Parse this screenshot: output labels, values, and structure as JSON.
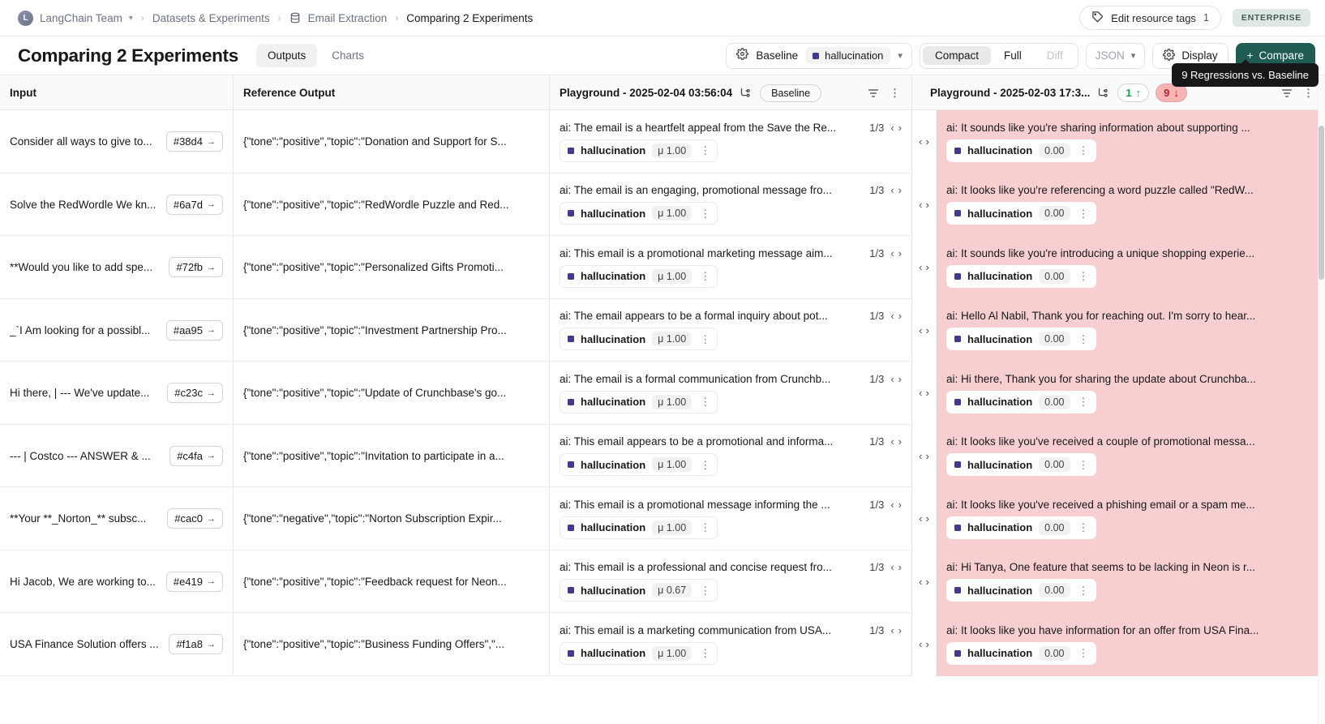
{
  "breadcrumb": {
    "team_initial": "L",
    "team": "LangChain Team",
    "level2": "Datasets & Experiments",
    "level3": "Email Extraction",
    "level4": "Comparing 2 Experiments",
    "tags_label": "Edit resource tags",
    "tags_count": "1",
    "plan_badge": "ENTERPRISE"
  },
  "toolbar": {
    "title": "Comparing 2 Experiments",
    "tabs": [
      {
        "label": "Outputs",
        "selected": true
      },
      {
        "label": "Charts",
        "selected": false
      }
    ],
    "baseline_label": "Baseline",
    "baseline_metric": "hallucination",
    "view_modes": [
      {
        "label": "Compact",
        "state": "active"
      },
      {
        "label": "Full",
        "state": "normal"
      },
      {
        "label": "Diff",
        "state": "disabled"
      }
    ],
    "json_label": "JSON",
    "display_label": "Display",
    "compare_label": "Compare",
    "compare_plus": "+",
    "tooltip": "9 Regressions vs. Baseline"
  },
  "table": {
    "headers": {
      "input": "Input",
      "reference_output": "Reference Output",
      "experiment_1": {
        "title": "Playground - 2025-02-04 03:56:04",
        "baseline_tag": "Baseline"
      },
      "experiment_2": {
        "title": "Playground - 2025-02-03 17:3...",
        "improvements": "1",
        "improvements_arrow": "↑",
        "regressions": "9",
        "regressions_arrow": "↓"
      }
    },
    "rows": [
      {
        "input": "Consider all ways to give to...",
        "hash": "#38d4",
        "reference": "{\"tone\":\"positive\",\"topic\":\"Donation and Support for S...",
        "exp1_text": "ai: The email is a heartfelt appeal from the Save the Re...",
        "exp1_frac": "1/3",
        "exp1_metric": "hallucination",
        "exp1_score": "μ 1.00",
        "exp2_text": "ai: It sounds like you're sharing information about supporting ...",
        "exp2_metric": "hallucination",
        "exp2_score": "0.00",
        "regression": true
      },
      {
        "input": "Solve the RedWordle We kn...",
        "hash": "#6a7d",
        "reference": "{\"tone\":\"positive\",\"topic\":\"RedWordle Puzzle and Red...",
        "exp1_text": "ai: The email is an engaging, promotional message fro...",
        "exp1_frac": "1/3",
        "exp1_metric": "hallucination",
        "exp1_score": "μ 1.00",
        "exp2_text": "ai: It looks like you're referencing a word puzzle called \"RedW...",
        "exp2_metric": "hallucination",
        "exp2_score": "0.00",
        "regression": true
      },
      {
        "input": "**Would you like to add spe...",
        "hash": "#72fb",
        "reference": "{\"tone\":\"positive\",\"topic\":\"Personalized Gifts Promoti...",
        "exp1_text": "ai: This email is a promotional marketing message aim...",
        "exp1_frac": "1/3",
        "exp1_metric": "hallucination",
        "exp1_score": "μ 1.00",
        "exp2_text": "ai: It sounds like you're introducing a unique shopping experie...",
        "exp2_metric": "hallucination",
        "exp2_score": "0.00",
        "regression": true
      },
      {
        "input": "_`I Am looking for a possibl...",
        "hash": "#aa95",
        "reference": "{\"tone\":\"positive\",\"topic\":\"Investment Partnership Pro...",
        "exp1_text": "ai: The email appears to be a formal inquiry about pot...",
        "exp1_frac": "1/3",
        "exp1_metric": "hallucination",
        "exp1_score": "μ 1.00",
        "exp2_text": "ai: Hello Al Nabil, Thank you for reaching out. I'm sorry to hear...",
        "exp2_metric": "hallucination",
        "exp2_score": "0.00",
        "regression": true
      },
      {
        "input": "Hi there, | --- We've update...",
        "hash": "#c23c",
        "reference": "{\"tone\":\"positive\",\"topic\":\"Update of Crunchbase's go...",
        "exp1_text": "ai: The email is a formal communication from Crunchb...",
        "exp1_frac": "1/3",
        "exp1_metric": "hallucination",
        "exp1_score": "μ 1.00",
        "exp2_text": "ai: Hi there, Thank you for sharing the update about Crunchba...",
        "exp2_metric": "hallucination",
        "exp2_score": "0.00",
        "regression": true
      },
      {
        "input": "--- | Costco --- ANSWER & ...",
        "hash": "#c4fa",
        "reference": "{\"tone\":\"positive\",\"topic\":\"Invitation to participate in a...",
        "exp1_text": "ai: This email appears to be a promotional and informa...",
        "exp1_frac": "1/3",
        "exp1_metric": "hallucination",
        "exp1_score": "μ 1.00",
        "exp2_text": "ai: It looks like you've received a couple of promotional messa...",
        "exp2_metric": "hallucination",
        "exp2_score": "0.00",
        "regression": true
      },
      {
        "input": "**Your **_Norton_** subsc...",
        "hash": "#cac0",
        "reference": "{\"tone\":\"negative\",\"topic\":\"Norton Subscription Expir...",
        "exp1_text": "ai: This email is a promotional message informing the ...",
        "exp1_frac": "1/3",
        "exp1_metric": "hallucination",
        "exp1_score": "μ 1.00",
        "exp2_text": "ai: It looks like you've received a phishing email or a spam me...",
        "exp2_metric": "hallucination",
        "exp2_score": "0.00",
        "regression": true
      },
      {
        "input": "Hi Jacob, We are working to...",
        "hash": "#e419",
        "reference": "{\"tone\":\"positive\",\"topic\":\"Feedback request for Neon...",
        "exp1_text": "ai: This email is a professional and concise request fro...",
        "exp1_frac": "1/3",
        "exp1_metric": "hallucination",
        "exp1_score": "μ 0.67",
        "exp2_text": "ai: Hi Tanya, One feature that seems to be lacking in Neon is r...",
        "exp2_metric": "hallucination",
        "exp2_score": "0.00",
        "regression": true
      },
      {
        "input": "USA Finance Solution offers ...",
        "hash": "#f1a8",
        "reference": "{\"tone\":\"positive\",\"topic\":\"Business Funding Offers\",\"...",
        "exp1_text": "ai: This email is a marketing communication from USA...",
        "exp1_frac": "1/3",
        "exp1_metric": "hallucination",
        "exp1_score": "μ 1.00",
        "exp2_text": "ai: It looks like you have information for an offer from USA Fina...",
        "exp2_metric": "hallucination",
        "exp2_score": "0.00",
        "regression": true
      }
    ]
  },
  "colors": {
    "accent_green": "#1f5c52",
    "regression_bg": "#f7cfd0",
    "metric_square": "#3f3c8f",
    "improvement_green": "#16a34a",
    "regression_red": "#b4232a"
  }
}
